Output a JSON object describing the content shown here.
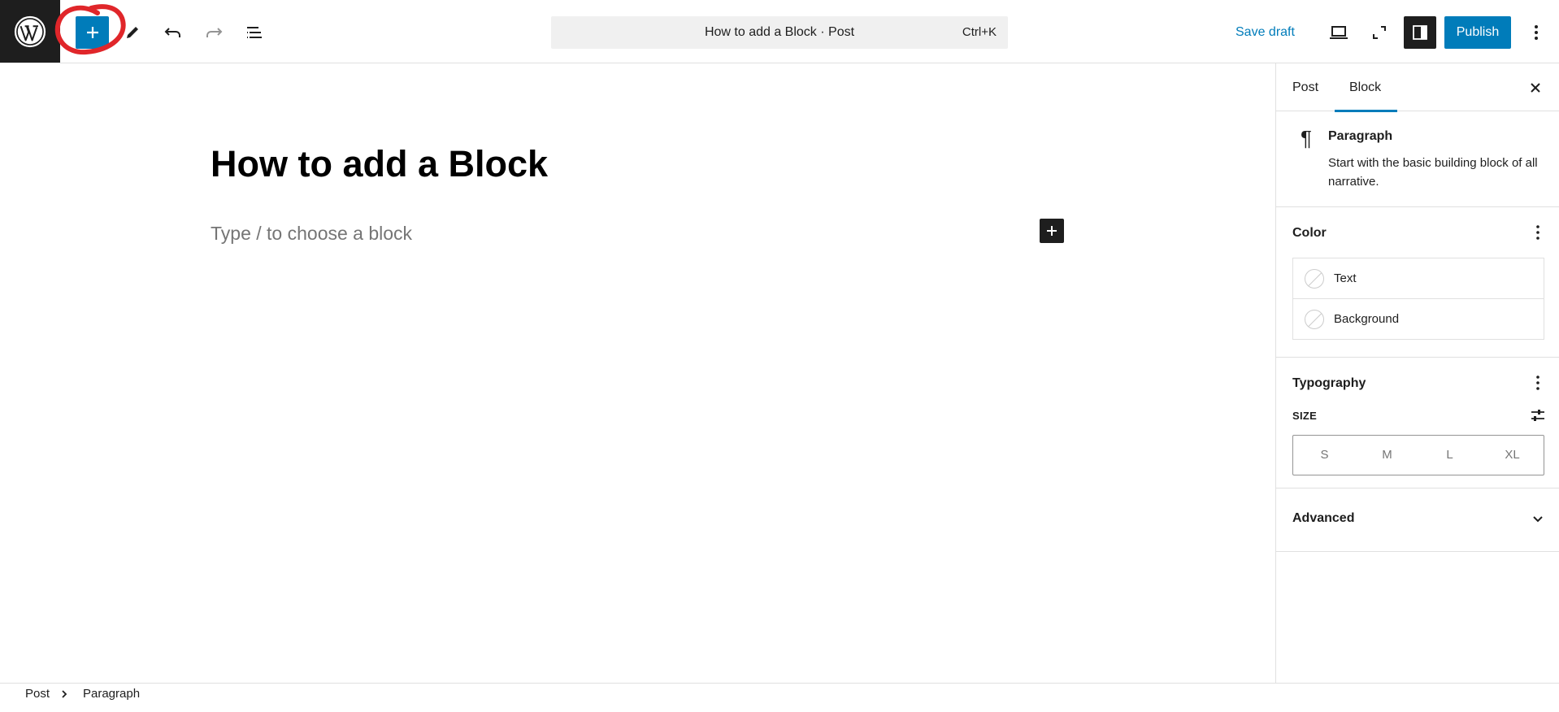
{
  "toolbar": {
    "document_title": "How to add a Block · Post",
    "shortcut": "Ctrl+K",
    "save_draft": "Save draft",
    "publish": "Publish"
  },
  "editor": {
    "post_title": "How to add a Block",
    "placeholder": "Type / to choose a block"
  },
  "sidebar": {
    "tabs": [
      {
        "label": "Post",
        "active": false
      },
      {
        "label": "Block",
        "active": true
      }
    ],
    "block": {
      "name": "Paragraph",
      "description": "Start with the basic building block of all narrative."
    },
    "color": {
      "title": "Color",
      "items": [
        {
          "label": "Text"
        },
        {
          "label": "Background"
        }
      ]
    },
    "typography": {
      "title": "Typography",
      "size_label": "SIZE",
      "sizes": [
        "S",
        "M",
        "L",
        "XL"
      ]
    },
    "advanced": {
      "title": "Advanced"
    }
  },
  "breadcrumb": [
    "Post",
    "Paragraph"
  ],
  "colors": {
    "accent": "#007cba",
    "dark": "#1e1e1e",
    "annotation": "#e0262a"
  }
}
